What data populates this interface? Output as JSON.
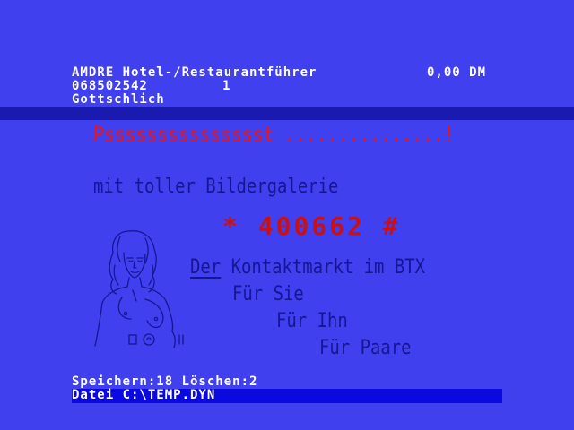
{
  "header": {
    "title": "AMDRE Hotel-/Restaurantführer",
    "price": "0,00 DM",
    "phone": "068502542",
    "count": "1",
    "name": "Gottschlich"
  },
  "page": {
    "psst_prefix": "Psssssssssssssss",
    "psst_t": "t",
    "psst_dots": " ...............!",
    "gallery": "mit toller Bildergalerie",
    "code": "* 400662 #",
    "contact_der": "Der",
    "contact_rest": " Kontaktmarkt im BTX",
    "for_her": "Für Sie",
    "for_him": "Für Ihn",
    "for_couples": "Für Paare"
  },
  "status": {
    "stats": "Speichern:18 Löschen:2",
    "file": "Datei C:\\TEMP.DYN"
  },
  "colors": {
    "background": "#4040ee",
    "header_text": "#ffffff",
    "accent_red": "#ee1414",
    "dark_blue_text": "#161694",
    "file_bar": "#0a0ae0"
  }
}
